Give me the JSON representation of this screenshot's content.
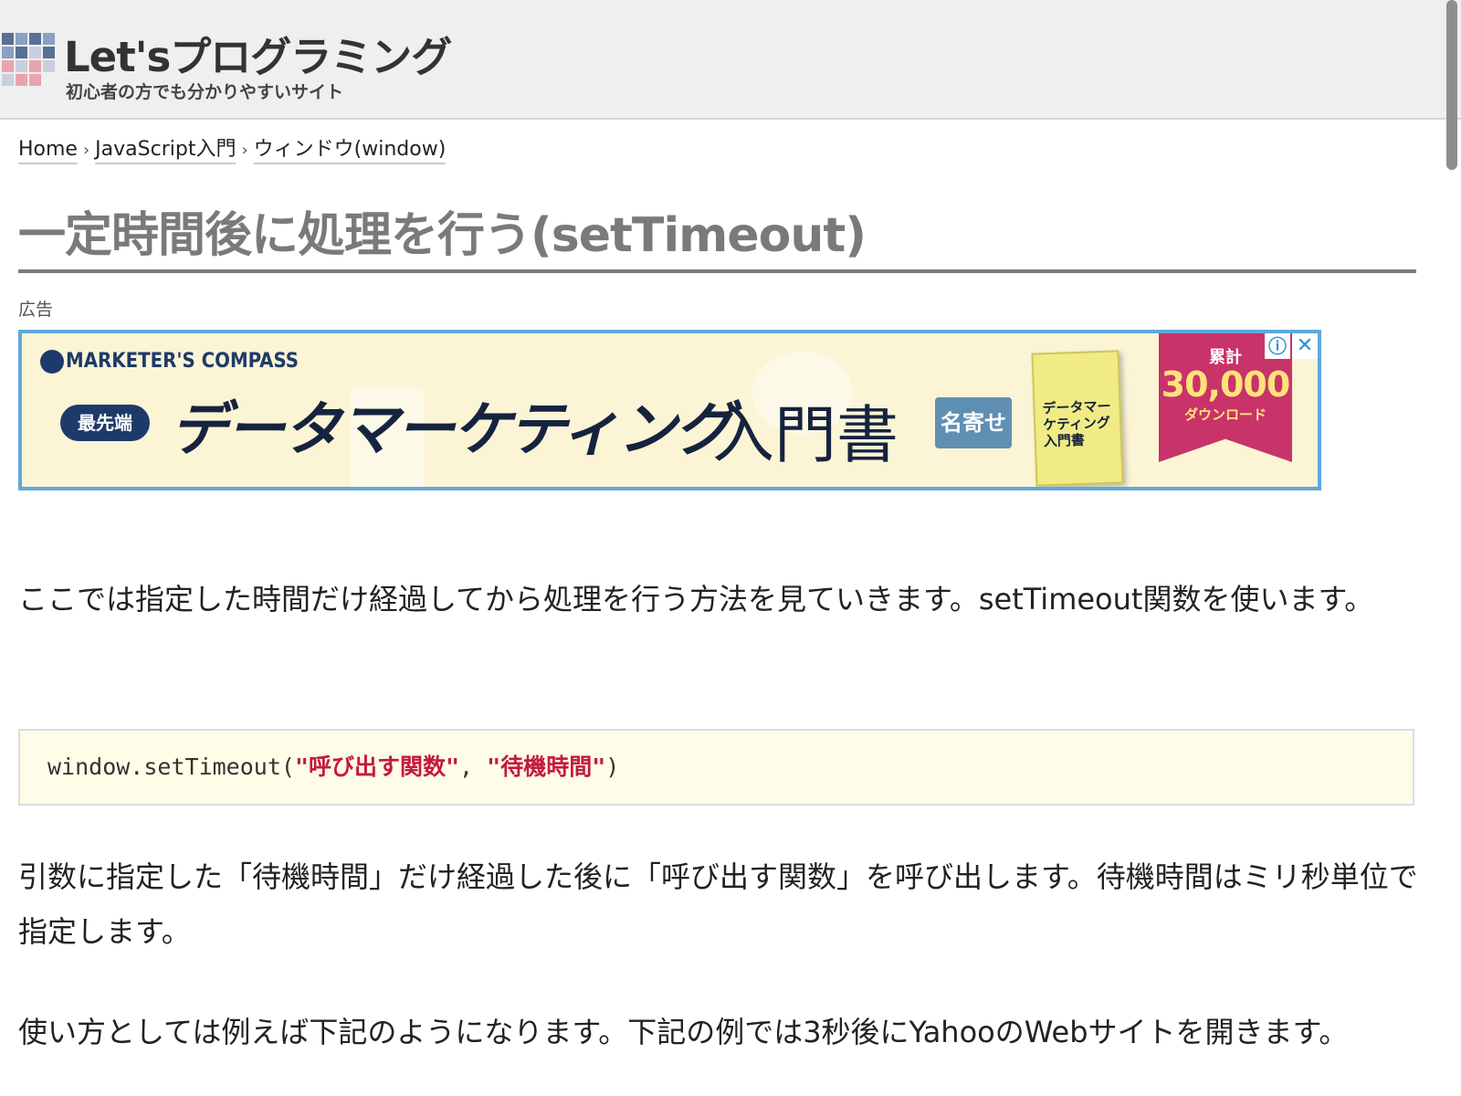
{
  "site": {
    "title": "Let'sプログラミング",
    "subtitle": "初心者の方でも分かりやすいサイト"
  },
  "breadcrumb": {
    "items": [
      "Home",
      "JavaScript入門",
      "ウィンドウ(window)"
    ],
    "separator": "›"
  },
  "page": {
    "title": "一定時間後に処理を行う(setTimeout)"
  },
  "ad": {
    "label": "広告",
    "brand": "MARKETER'S COMPASS",
    "badge": "最先端",
    "headline": "データマーケティング",
    "headline2": "入門書",
    "mini_badge": "名寄せ",
    "book_text": "データマーケティング入門書",
    "ribbon_small": "累計",
    "ribbon_big": "30,000",
    "ribbon_sub": "ダウンロード",
    "info_icon": "ⓘ",
    "close_icon": "✕"
  },
  "content": {
    "para1": "ここでは指定した時間だけ経過してから処理を行う方法を見ていきます。setTimeout関数を使います。",
    "code": {
      "prefix": "window.setTimeout(",
      "arg1": "\"呼び出す関数\"",
      "comma": ", ",
      "arg2": "\"待機時間\"",
      "suffix": ")"
    },
    "para2": "引数に指定した「待機時間」だけ経過した後に「呼び出す関数」を呼び出します。待機時間はミリ秒単位で指定します。",
    "para3": "使い方としては例えば下記のようになります。下記の例では3秒後にYahooのWebサイトを開きます。"
  },
  "colors": {
    "header_bg": "#efefef",
    "title_gray": "#7a7a7a",
    "ad_border": "#5ea9dc",
    "code_string": "#c41a3c",
    "code_bg": "#fefde8"
  }
}
